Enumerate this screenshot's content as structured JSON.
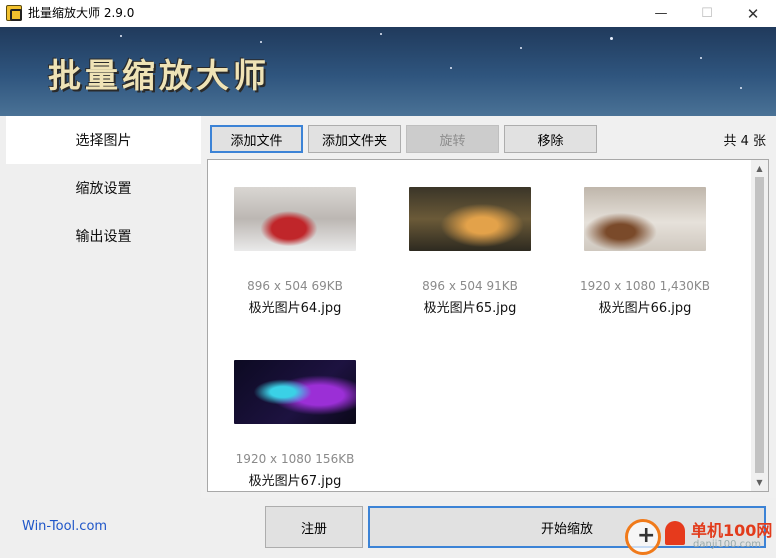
{
  "window": {
    "title": "批量缩放大师 2.9.0",
    "minimize_glyph": "—",
    "maximize_glyph": "☐",
    "close_glyph": "✕"
  },
  "banner": {
    "title": "批量缩放大师"
  },
  "sidebar": {
    "items": [
      {
        "label": "选择图片",
        "active": true
      },
      {
        "label": "缩放设置",
        "active": false
      },
      {
        "label": "输出设置",
        "active": false
      }
    ]
  },
  "toolbar": {
    "add_file": "添加文件",
    "add_folder": "添加文件夹",
    "rotate": "旋转",
    "remove": "移除",
    "count": "共 4 张"
  },
  "images": [
    {
      "meta": "896 x 504 69KB",
      "name": "极光图片64.jpg"
    },
    {
      "meta": "896 x 504 91KB",
      "name": "极光图片65.jpg"
    },
    {
      "meta": "1920 x 1080 1,430KB",
      "name": "极光图片66.jpg"
    },
    {
      "meta": "1920 x 1080 156KB",
      "name": "极光图片67.jpg"
    }
  ],
  "bottom": {
    "site": "Win-Tool.com",
    "register": "注册",
    "start": "开始缩放"
  },
  "watermark": {
    "text": "单机100网",
    "sub": "danji100.com"
  },
  "colors": {
    "accent": "#3c83d6",
    "link": "#1f56c8",
    "banner_top": "#203a5c",
    "banner_bottom": "#4a7296"
  }
}
